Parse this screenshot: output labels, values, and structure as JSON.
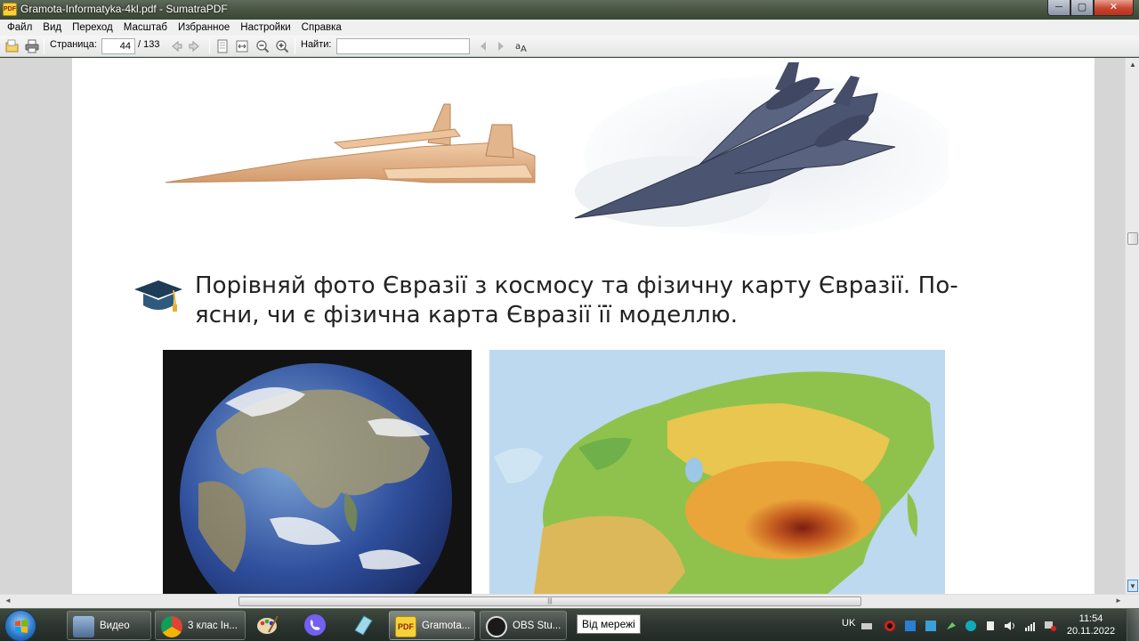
{
  "window": {
    "title": "Gramota-Informatyka-4kl.pdf - SumatraPDF",
    "app_icon_label": "PDF",
    "min_label": "─",
    "max_label": "▢",
    "close_label": "✕"
  },
  "menu": [
    "Файл",
    "Вид",
    "Переход",
    "Масштаб",
    "Избранное",
    "Настройки",
    "Справка"
  ],
  "toolbar": {
    "page_label": "Страница:",
    "page_value": "44",
    "page_total": "/ 133",
    "find_label": "Найти:",
    "find_value": ""
  },
  "document": {
    "question_text": "Порівняй фото Євразії з космосу та фізичну карту Євразії. По-\nясни, чи є фізична карта Євразії її моделлю."
  },
  "taskbar": {
    "tasks": [
      {
        "label": "Видео"
      },
      {
        "label": "3 клас Ін..."
      },
      {
        "label": "Gramota..."
      },
      {
        "label": "OBS Stu..."
      }
    ],
    "tooltip": "Від мережі",
    "language": "UK",
    "time": "11:54",
    "date": "20.11.2022"
  },
  "colors": {
    "page_background": "#ffffff",
    "doc_background": "#d6d6d6",
    "taskbar": "#2c3530"
  }
}
